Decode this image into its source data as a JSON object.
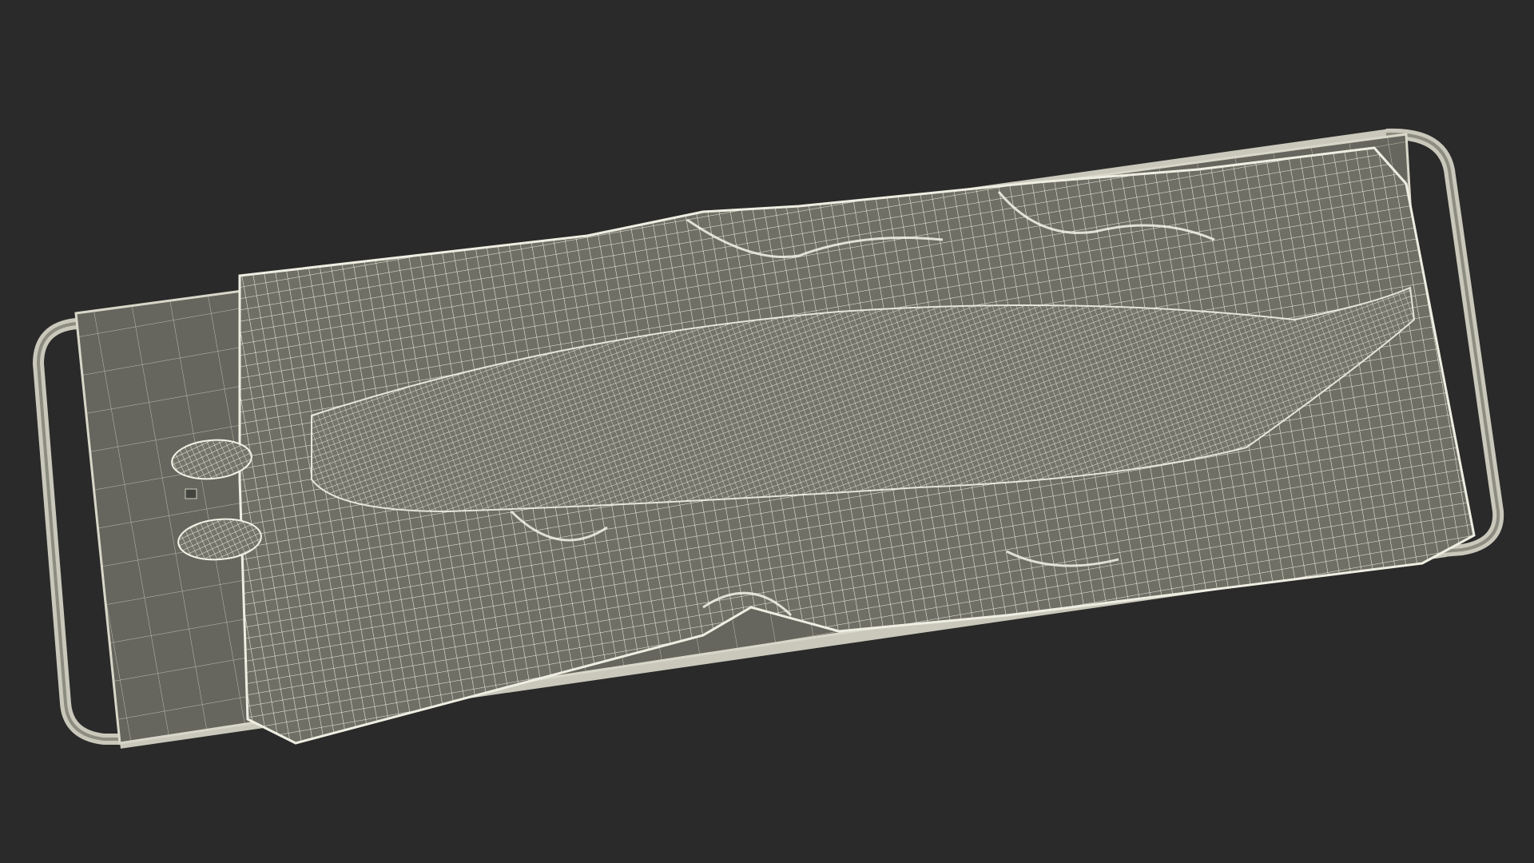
{
  "scene": {
    "subject": "wireframe-stretcher-with-sheet-covered-body",
    "colors": {
      "background": "#2a2a2a",
      "surface": "#6f6f66",
      "surface_dark": "#5f5f57",
      "wire": "#efeee2",
      "frame": "#c9c8bb"
    }
  }
}
